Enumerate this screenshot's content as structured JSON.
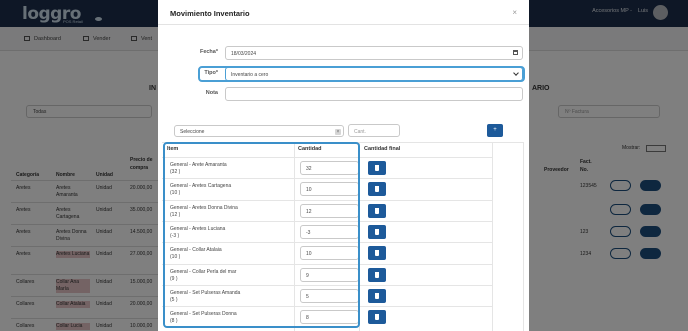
{
  "app": {
    "logo": "loggro",
    "logo_sub": "POS Retail",
    "account": "Accesorios MP -",
    "user": "Luis",
    "nav": [
      "Dashboard",
      "Vender",
      "Vent"
    ],
    "heading_left": "IN",
    "heading_right": "ARIO",
    "filter_value": "Todas",
    "search_placeholder": "Nº Factura",
    "mostrar_label": "Mostrar:",
    "table_headers": [
      "Categoría",
      "Nombre",
      "Unidad",
      "Precio de compra"
    ],
    "rows": [
      {
        "categoria": "Aretes",
        "nombre": "Aretes Amaranta",
        "unidad": "Unidad",
        "precio": "20.000,00"
      },
      {
        "categoria": "Aretes",
        "nombre": "Aretes Cartagena",
        "unidad": "Unidad",
        "precio": "35.000,00"
      },
      {
        "categoria": "Aretes",
        "nombre": "Aretes Donna Divina",
        "unidad": "Unidad",
        "precio": "14.500,00"
      },
      {
        "categoria": "Aretes",
        "nombre": "Aretes Luciana",
        "unidad": "Unidad",
        "precio": "27.000,00"
      },
      {
        "categoria": "Collares",
        "nombre": "Collar Ana María",
        "unidad": "Unidad",
        "precio": "15.000,00"
      },
      {
        "categoria": "Collares",
        "nombre": "Collar Atalaia",
        "unidad": "Unidad",
        "precio": "20.000,00"
      },
      {
        "categoria": "Collares",
        "nombre": "Collar Lucia",
        "unidad": "Unidad",
        "precio": "10.000,00"
      }
    ],
    "right_headers": [
      "Proveedor",
      "Fact. No."
    ],
    "right_values": [
      "123545",
      "",
      "123",
      "1234"
    ]
  },
  "modal": {
    "title": "Movimiento Inventario",
    "close": "×",
    "fecha_label": "Fecha*",
    "fecha_value": "18/03/2024",
    "tipo_label": "Tipo*",
    "tipo_value": "Inventario a cero",
    "nota_label": "Nota",
    "nota_value": "",
    "product_select": "Seleccione",
    "product_clear": "×",
    "cant_placeholder": "Cant.",
    "add_button": "+",
    "columns": {
      "item": "Item",
      "cantidad": "Cantidad",
      "cantidad_final": "Cantidad final"
    },
    "items": [
      {
        "name": "General - Arete Amaranta",
        "stock": "(32 )",
        "cantidad": "32"
      },
      {
        "name": "General - Aretes Cartagena",
        "stock": "(10 )",
        "cantidad": "10"
      },
      {
        "name": "General - Aretes Donna Divina",
        "stock": "(12 )",
        "cantidad": "12"
      },
      {
        "name": "General - Aretes Luciana",
        "stock": "(-3 )",
        "cantidad": "-3"
      },
      {
        "name": "General - Collar Atalaia",
        "stock": "(10 )",
        "cantidad": "10"
      },
      {
        "name": "General - Collar Perla del mar",
        "stock": "(9 )",
        "cantidad": "9"
      },
      {
        "name": "General - Set Pulseras Amanda",
        "stock": "(5 )",
        "cantidad": "5"
      },
      {
        "name": "General - Set Pulseras Donna",
        "stock": "(8 )",
        "cantidad": "8"
      }
    ]
  },
  "colors": {
    "primary": "#1d5a9a",
    "focus_outline": "#4a9fd5",
    "topbar": "#1c2f4d"
  }
}
